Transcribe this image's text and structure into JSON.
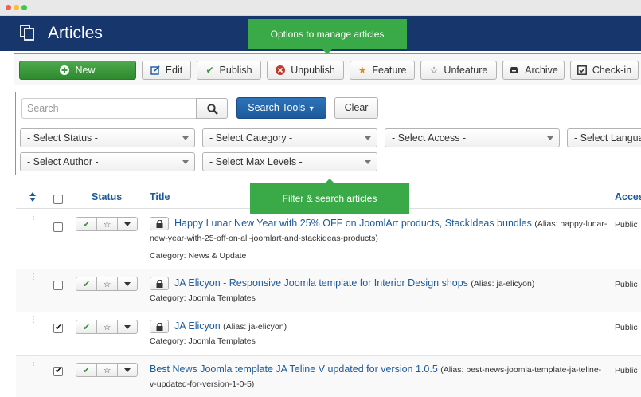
{
  "header": {
    "title": "Articles",
    "logo_icon": "copy-icon"
  },
  "callouts": {
    "toolbar": "Options to manage articles",
    "filters": "Filter & search articles"
  },
  "toolbar": {
    "new": "New",
    "edit": "Edit",
    "publish": "Publish",
    "unpublish": "Unpublish",
    "feature": "Feature",
    "unfeature": "Unfeature",
    "archive": "Archive",
    "checkin": "Check-in"
  },
  "filters": {
    "search_placeholder": "Search",
    "search_tools": "Search Tools",
    "clear": "Clear",
    "status": "- Select Status -",
    "category": "- Select Category -",
    "access": "- Select Access -",
    "language": "- Select Language -",
    "author": "- Select Author -",
    "max_levels": "- Select Max Levels -"
  },
  "table": {
    "columns": {
      "status": "Status",
      "title": "Title",
      "access": "Access"
    },
    "rows": [
      {
        "checked": false,
        "title": "Happy Lunar New Year with 25% OFF on JoomlArt products, StackIdeas bundles",
        "alias": "(Alias: happy-lunar-new-year-with-25-off-on-all-joomlart-and-stackideas-products)",
        "category": "Category: News & Update",
        "access": "Public",
        "locked": true
      },
      {
        "checked": false,
        "title": "JA Elicyon - Responsive Joomla template for Interior Design shops",
        "alias": "(Alias: ja-elicyon)",
        "category": "Category: Joomla Templates",
        "access": "Public",
        "locked": true
      },
      {
        "checked": true,
        "title": "JA Elicyon",
        "alias": "(Alias: ja-elicyon)",
        "category": "Category: Joomla Templates",
        "access": "Public",
        "locked": true
      },
      {
        "checked": true,
        "title": "Best News Joomla template JA Teline V updated for version 1.0.5",
        "alias": "(Alias: best-news-joomla-template-ja-teline-v-updated-for-version-1-0-5)",
        "category": "",
        "access": "Public",
        "locked": false
      }
    ]
  },
  "colors": {
    "header_bg": "#17366b",
    "callout_bg": "#3aaa48",
    "highlight_border": "#e27c3e",
    "primary_button": "#1c5a9c",
    "new_button": "#3a9a3a"
  }
}
